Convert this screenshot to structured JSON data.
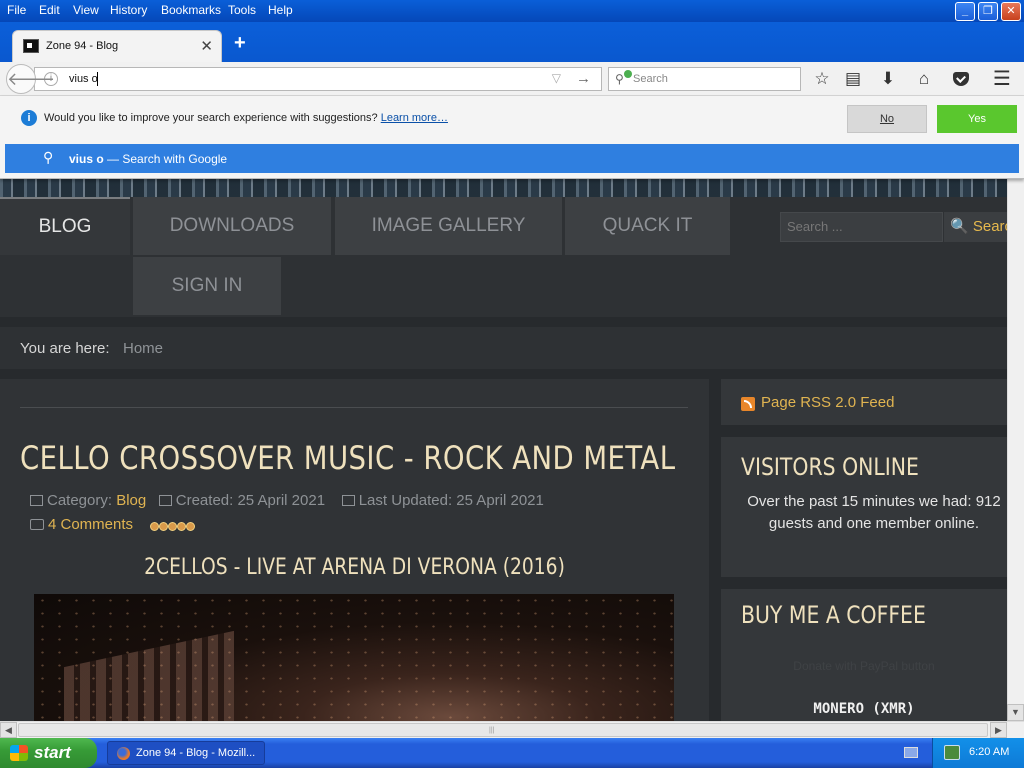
{
  "menubar": {
    "items": [
      "File",
      "Edit",
      "View",
      "History",
      "Bookmarks",
      "Tools",
      "Help"
    ],
    "minimize": "_",
    "restore": "❐",
    "close": "✕"
  },
  "tabs": {
    "active_title": "Zone 94 - Blog",
    "close_glyph": "✕",
    "new_tab_glyph": "+"
  },
  "navbar": {
    "back_glyph": "🡐",
    "info_glyph": "i",
    "url_value": "vius o",
    "dropdown_glyph": "▽",
    "go_glyph": "→",
    "search_placeholder": "Search",
    "bookmark_glyph": "☆",
    "library_glyph": "▤",
    "download_glyph": "⬇",
    "home_glyph": "⌂",
    "menu_glyph": "☰"
  },
  "suggestions": {
    "question": "Would you like to improve your search experience with suggestions?",
    "learn_more": "Learn more…",
    "no_label": "No",
    "yes_label": "Yes",
    "row_query": "vius o",
    "row_suffix": "— Search with Google",
    "row_icon": "⚲"
  },
  "site": {
    "nav": [
      "BLOG",
      "DOWNLOADS",
      "IMAGE GALLERY",
      "QUACK IT",
      "SIGN IN"
    ],
    "search_placeholder": "Search ...",
    "search_button": "🔍 Search",
    "breadcrumb_label": "You are here:",
    "breadcrumb_home": "Home"
  },
  "article": {
    "title": "CELLO CROSSOVER MUSIC - ROCK AND METAL",
    "category_label": "Category:",
    "category_value": "Blog",
    "created": "Created: 25 April 2021",
    "updated": "Last Updated: 25 April 2021",
    "comments": "4 Comments",
    "rating_stars": 5,
    "video_title": "2CELLOS - LIVE AT ARENA DI VERONA (2016)"
  },
  "sidebar": {
    "rss": "Page RSS 2.0 Feed",
    "visitors_title": "VISITORS ONLINE",
    "visitors_text": "Over the past 15 minutes we had: 912 guests and one member online.",
    "coffee_title": "BUY ME A COFFEE",
    "coffee_paypal": "Donate with PayPal button",
    "coffee_monero": "MONERO (XMR)"
  },
  "scrollbars": {
    "down_glyph": "▼",
    "left_glyph": "◀",
    "right_glyph": "▶",
    "grip": "|||"
  },
  "taskbar": {
    "start_label": "start",
    "task_label": "Zone 94 - Blog - Mozill...",
    "time": "6:20 AM"
  },
  "colors": {
    "page_bg": "#272a2d",
    "accent_gold": "#e0b451",
    "title_cream": "#efe1bd",
    "suggest_blue": "#2f7fe0",
    "yes_green": "#5ac72e"
  }
}
